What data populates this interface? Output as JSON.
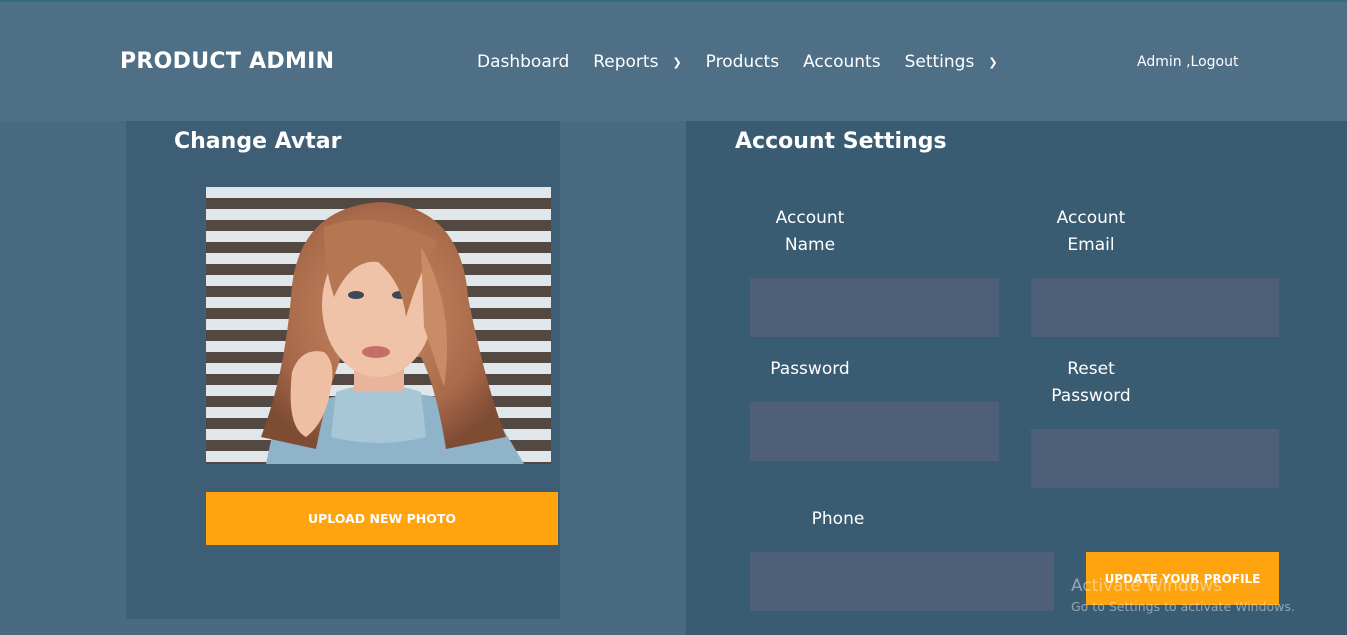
{
  "header": {
    "brand": "PRODUCT ADMIN",
    "nav": [
      {
        "label": "Dashboard",
        "has_dropdown": false
      },
      {
        "label": "Reports",
        "has_dropdown": true
      },
      {
        "label": "Products",
        "has_dropdown": false
      },
      {
        "label": "Accounts",
        "has_dropdown": false
      },
      {
        "label": "Settings",
        "has_dropdown": true
      }
    ],
    "user_text": "Admin ,Logout"
  },
  "avatar_panel": {
    "title": "Change Avtar",
    "upload_label": "UPLOAD NEW PHOTO"
  },
  "account_panel": {
    "title": "Account Settings",
    "fields": {
      "account_name": {
        "label_line1": "Account",
        "label_line2": "Name",
        "value": ""
      },
      "account_email": {
        "label_line1": "Account",
        "label_line2": "Email",
        "value": ""
      },
      "password": {
        "label": "Password",
        "value": ""
      },
      "reset_password": {
        "label_line1": "Reset",
        "label_line2": "Password",
        "value": ""
      },
      "phone": {
        "label": "Phone",
        "value": ""
      }
    },
    "update_label": "UPDATE YOUR PROFILE"
  },
  "watermark": {
    "line1": "Activate Windows",
    "line2": "Go to Settings to activate Windows."
  },
  "colors": {
    "background": "#4a6a82",
    "header": "#4e6f86",
    "panel": "#3a5c72",
    "input": "#4e6078",
    "accent": "#ffa40e"
  }
}
